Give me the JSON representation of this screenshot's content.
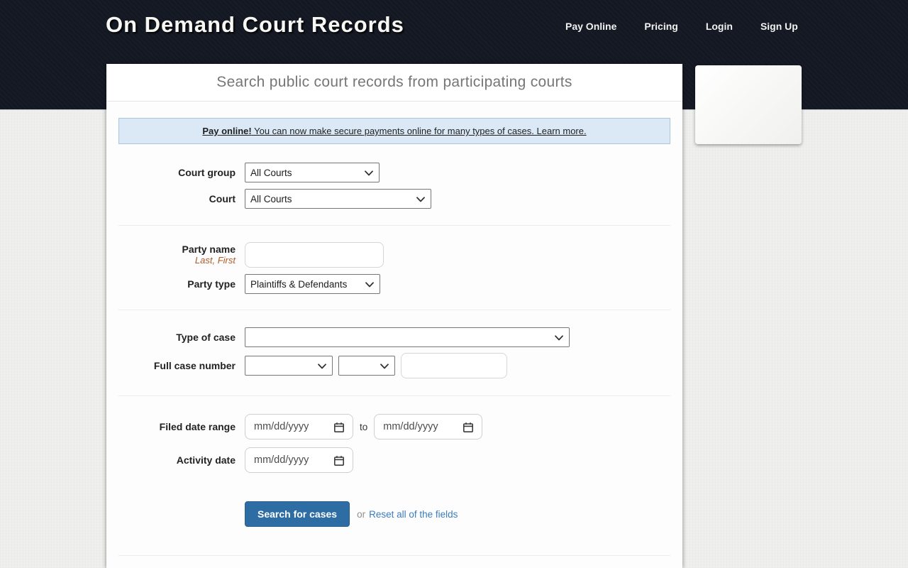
{
  "header": {
    "logo": "On Demand Court Records",
    "nav": [
      {
        "label": "Pay Online"
      },
      {
        "label": "Pricing"
      },
      {
        "label": "Login"
      },
      {
        "label": "Sign Up"
      }
    ]
  },
  "card": {
    "title": "Search public court records from participating courts",
    "banner": {
      "bold": "Pay online!",
      "text": " You can now make secure payments online for many types of cases. Learn more."
    }
  },
  "form": {
    "court_group": {
      "label": "Court group",
      "value": "All Courts"
    },
    "court": {
      "label": "Court",
      "value": "All Courts"
    },
    "party_name": {
      "label": "Party name",
      "hint": "Last, First",
      "value": ""
    },
    "party_type": {
      "label": "Party type",
      "value": "Plaintiffs & Defendants"
    },
    "type_of_case": {
      "label": "Type of case",
      "value": ""
    },
    "full_case_number": {
      "label": "Full case number",
      "select1_value": "",
      "select2_value": "",
      "number_value": ""
    },
    "filed_date_range": {
      "label": "Filed date range",
      "from_placeholder": "mm/dd/yyyy",
      "separator": "to",
      "to_placeholder": "mm/dd/yyyy"
    },
    "activity_date": {
      "label": "Activity date",
      "placeholder": "mm/dd/yyyy"
    },
    "actions": {
      "search_label": "Search for cases",
      "or": "or",
      "reset_label": "Reset all of the fields"
    }
  },
  "colors": {
    "header_bg": "#141823",
    "page_bg": "#eff0ee",
    "banner_bg": "#dbe9f6",
    "banner_border": "#a9c7e1",
    "button_bg": "#2e6da4",
    "link": "#3a7cbf",
    "hint": "#ad5b28"
  }
}
